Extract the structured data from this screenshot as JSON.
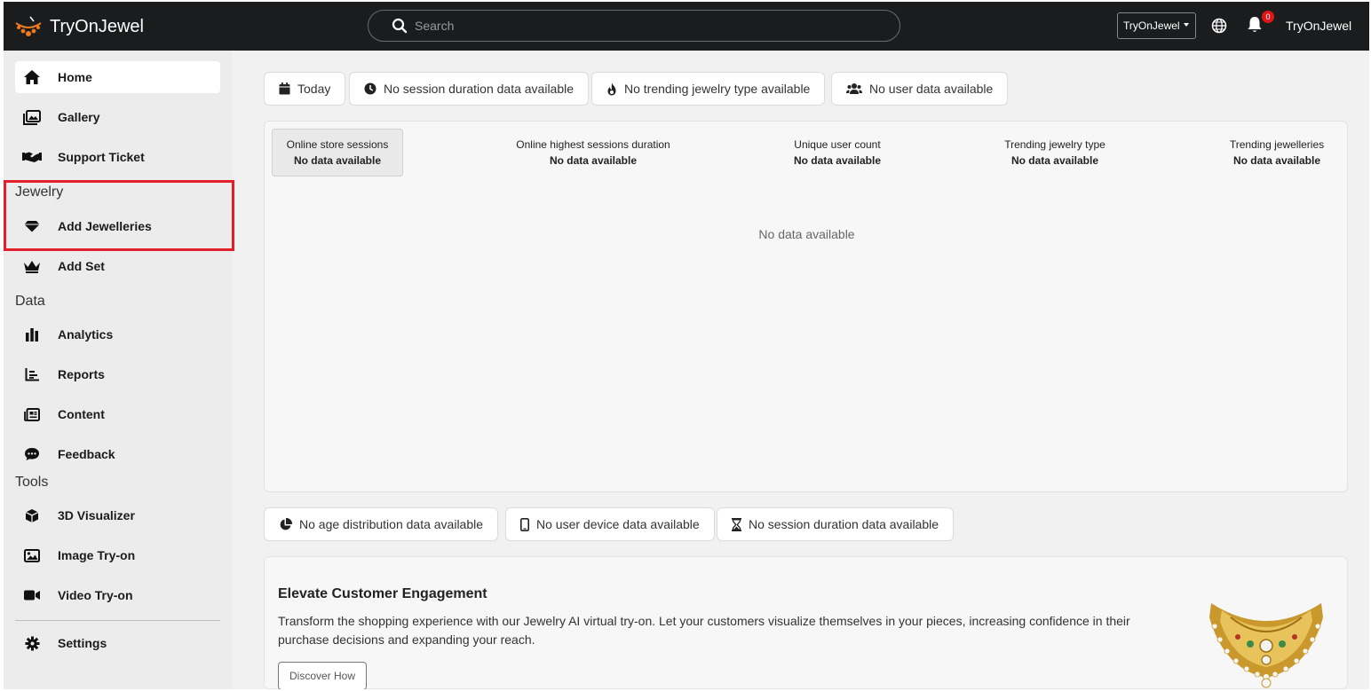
{
  "brand": {
    "name": "TryOnJewel"
  },
  "search": {
    "placeholder": "Search"
  },
  "header": {
    "store_select": "TryOnJewel",
    "notification_count": "0",
    "user_name": "TryOnJewel"
  },
  "sidebar": {
    "items_top": [
      {
        "label": "Home",
        "icon": "home-icon"
      },
      {
        "label": "Gallery",
        "icon": "gallery-icon"
      },
      {
        "label": "Support Ticket",
        "icon": "handshake-icon"
      }
    ],
    "section_jewelry": "Jewelry",
    "items_jewelry": [
      {
        "label": "Add Jewelleries",
        "icon": "gem-icon"
      },
      {
        "label": "Add Set",
        "icon": "crown-icon"
      }
    ],
    "section_data": "Data",
    "items_data": [
      {
        "label": "Analytics",
        "icon": "bar-chart-icon"
      },
      {
        "label": "Reports",
        "icon": "line-chart-icon"
      },
      {
        "label": "Content",
        "icon": "newspaper-icon"
      },
      {
        "label": "Feedback",
        "icon": "comment-icon"
      }
    ],
    "section_tools": "Tools",
    "items_tools": [
      {
        "label": "3D Visualizer",
        "icon": "cube-icon"
      },
      {
        "label": "Image Try-on",
        "icon": "image-icon"
      },
      {
        "label": "Video Try-on",
        "icon": "video-icon"
      }
    ],
    "settings_label": "Settings"
  },
  "filters": {
    "today": "Today",
    "session_duration": "No session duration data available",
    "trending_type": "No trending jewelry type available",
    "user_data": "No user data available"
  },
  "stats": {
    "online_sessions": {
      "title": "Online store sessions",
      "value": "No data available"
    },
    "highest_duration": {
      "title": "Online highest sessions duration",
      "value": "No data available"
    },
    "unique_users": {
      "title": "Unique user count",
      "value": "No data available"
    },
    "trending_type": {
      "title": "Trending jewelry type",
      "value": "No data available"
    },
    "trending_jewelleries": {
      "title": "Trending jewelleries",
      "value": "No data available"
    },
    "empty_message": "No data available"
  },
  "bottom_chips": {
    "age": "No age distribution data available",
    "device": "No user device data available",
    "session": "No session duration data available"
  },
  "promo": {
    "title": "Elevate Customer Engagement",
    "text": "Transform the shopping experience with our Jewelry AI virtual try-on. Let your customers visualize themselves in your pieces, increasing confidence in their purchase decisions and expanding your reach.",
    "button": "Discover How"
  },
  "colors": {
    "topbar": "#1b1c1e",
    "sidebar": "#ececec",
    "highlight": "#e3202a",
    "badge": "#e01515",
    "logo_orange": "#f07a1a"
  }
}
